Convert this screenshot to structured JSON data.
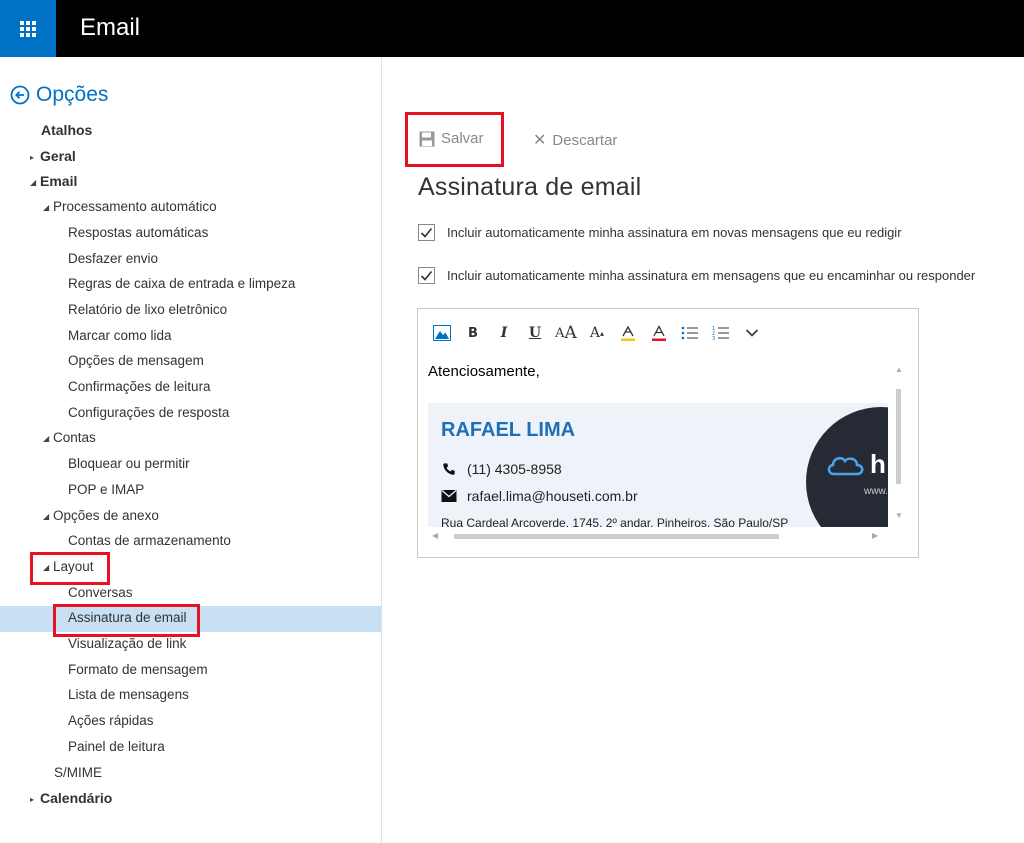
{
  "header": {
    "title": "Email",
    "launcher_icon": "waffle-icon"
  },
  "sidebar": {
    "back_label": "Opções",
    "items": [
      {
        "label": "Atalhos",
        "level": 0,
        "bold": true,
        "expander": "none"
      },
      {
        "label": "Geral",
        "level": 0,
        "bold": true,
        "expander": "collapsed"
      },
      {
        "label": "Email",
        "level": 0,
        "bold": true,
        "expander": "expanded"
      },
      {
        "label": "Processamento automático",
        "level": 1,
        "bold": false,
        "expander": "expanded"
      },
      {
        "label": "Respostas automáticas",
        "level": 2,
        "bold": false,
        "expander": "none"
      },
      {
        "label": "Desfazer envio",
        "level": 2,
        "bold": false,
        "expander": "none"
      },
      {
        "label": "Regras de caixa de entrada e limpeza",
        "level": 2,
        "bold": false,
        "expander": "none"
      },
      {
        "label": "Relatório de lixo eletrônico",
        "level": 2,
        "bold": false,
        "expander": "none"
      },
      {
        "label": "Marcar como lida",
        "level": 2,
        "bold": false,
        "expander": "none"
      },
      {
        "label": "Opções de mensagem",
        "level": 2,
        "bold": false,
        "expander": "none"
      },
      {
        "label": "Confirmações de leitura",
        "level": 2,
        "bold": false,
        "expander": "none"
      },
      {
        "label": "Configurações de resposta",
        "level": 2,
        "bold": false,
        "expander": "none"
      },
      {
        "label": "Contas",
        "level": 1,
        "bold": false,
        "expander": "expanded"
      },
      {
        "label": "Bloquear ou permitir",
        "level": 2,
        "bold": false,
        "expander": "none"
      },
      {
        "label": "POP e IMAP",
        "level": 2,
        "bold": false,
        "expander": "none"
      },
      {
        "label": "Opções de anexo",
        "level": 1,
        "bold": false,
        "expander": "expanded"
      },
      {
        "label": "Contas de armazenamento",
        "level": 2,
        "bold": false,
        "expander": "none"
      },
      {
        "label": "Layout",
        "level": 1,
        "bold": false,
        "expander": "expanded"
      },
      {
        "label": "Conversas",
        "level": 2,
        "bold": false,
        "expander": "none"
      },
      {
        "label": "Assinatura de email",
        "level": 2,
        "bold": false,
        "expander": "none",
        "selected": true
      },
      {
        "label": "Visualização de link",
        "level": 2,
        "bold": false,
        "expander": "none"
      },
      {
        "label": "Formato de mensagem",
        "level": 2,
        "bold": false,
        "expander": "none"
      },
      {
        "label": "Lista de mensagens",
        "level": 2,
        "bold": false,
        "expander": "none"
      },
      {
        "label": "Ações rápidas",
        "level": 2,
        "bold": false,
        "expander": "none"
      },
      {
        "label": "Painel de leitura",
        "level": 2,
        "bold": false,
        "expander": "none"
      },
      {
        "label": "S/MIME",
        "level": 1,
        "bold": false,
        "expander": "none"
      },
      {
        "label": "Calendário",
        "level": 0,
        "bold": true,
        "expander": "collapsed"
      }
    ]
  },
  "toolbar": {
    "save_label": "Salvar",
    "discard_label": "Descartar"
  },
  "main": {
    "title": "Assinatura de email",
    "checkboxes": [
      {
        "label": "Incluir automaticamente minha assinatura em novas mensagens que eu redigir",
        "checked": true
      },
      {
        "label": "Incluir automaticamente minha assinatura em mensagens que eu encaminhar ou responder",
        "checked": true
      }
    ]
  },
  "editor": {
    "toolbar_icons": [
      "image-icon",
      "bold-icon",
      "italic-icon",
      "underline-icon",
      "font-size-icon",
      "grow-font-icon",
      "highlight-icon",
      "font-color-icon",
      "bullets-icon",
      "numbering-icon",
      "more-icon"
    ],
    "greeting": "Atenciosamente,",
    "signature": {
      "name": "RAFAEL LIMA",
      "phone": "(11) 4305-8958",
      "email": "rafael.lima@houseti.com.br",
      "address": "Rua Cardeal Arcoverde, 1745, 2º andar, Pinheiros, São Paulo/SP",
      "logo_letter": "h",
      "website_partial": "www."
    }
  },
  "colors": {
    "accent": "#0072c6",
    "highlight_box": "#e81123",
    "selected_bg": "#c7e0f4",
    "signature_name": "#1f6fb5"
  }
}
